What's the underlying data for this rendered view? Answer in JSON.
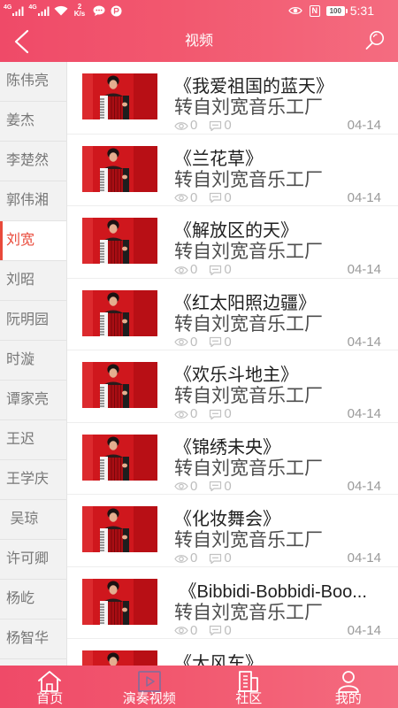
{
  "status_bar": {
    "network_1": "4G",
    "network_2": "4G",
    "speed_value": "2",
    "speed_unit": "K/s",
    "nfc_label": "N",
    "battery": "100",
    "time": "5:31",
    "icons": [
      "signal-icon",
      "signal-icon",
      "wifi-icon",
      "message-bubble-icon",
      "app-notification-icon",
      "eye-icon",
      "nfc-icon",
      "battery-icon"
    ]
  },
  "header": {
    "title": "视频",
    "back_icon": "chevron-left-icon",
    "search_icon": "search-icon"
  },
  "colors": {
    "brand_start": "#ef4a68",
    "brand_end": "#f46c80",
    "sidebar_active": "#e9493a",
    "sidebar_text": "#777777",
    "muted_text": "#9a9a9a",
    "nav_active_icon": "#8a6a98"
  },
  "sidebar": {
    "items": [
      {
        "name": "陈伟亮"
      },
      {
        "name": "姜杰"
      },
      {
        "name": "李楚然"
      },
      {
        "name": "郭伟湘"
      },
      {
        "name": "刘宽",
        "selected": true
      },
      {
        "name": "刘昭"
      },
      {
        "name": "阮明园"
      },
      {
        "name": "时漩"
      },
      {
        "name": "谭家亮"
      },
      {
        "name": "王迟"
      },
      {
        "name": "王学庆"
      },
      {
        "name": " 吴琼"
      },
      {
        "name": "许可卿"
      },
      {
        "name": "杨屹"
      },
      {
        "name": "杨智华"
      }
    ]
  },
  "videos": [
    {
      "title": "《我爱祖国的蓝天》",
      "source": "转自刘宽音乐工厂",
      "views": "0",
      "comments": "0",
      "date": "04-14"
    },
    {
      "title": "《兰花草》",
      "source": "转自刘宽音乐工厂",
      "views": "0",
      "comments": "0",
      "date": "04-14"
    },
    {
      "title": "《解放区的天》",
      "source": "转自刘宽音乐工厂",
      "views": "0",
      "comments": "0",
      "date": "04-14"
    },
    {
      "title": "《红太阳照边疆》",
      "source": "转自刘宽音乐工厂",
      "views": "0",
      "comments": "0",
      "date": "04-14"
    },
    {
      "title": "《欢乐斗地主》",
      "source": "转自刘宽音乐工厂",
      "views": "0",
      "comments": "0",
      "date": "04-14"
    },
    {
      "title": "《锦绣未央》",
      "source": "转自刘宽音乐工厂",
      "views": "0",
      "comments": "0",
      "date": "04-14"
    },
    {
      "title": "《化妆舞会》",
      "source": "转自刘宽音乐工厂",
      "views": "0",
      "comments": "0",
      "date": "04-14"
    },
    {
      "title": " 《Bibbidi-Bobbidi-Boo...",
      "source": "转自刘宽音乐工厂",
      "views": "0",
      "comments": "0",
      "date": "04-14"
    },
    {
      "title": "《大风车》"
    }
  ],
  "bottom_nav": {
    "tabs": [
      {
        "label": "首页",
        "icon": "home-icon"
      },
      {
        "label": "演奏视频",
        "icon": "video-play-icon",
        "active": true
      },
      {
        "label": "社区",
        "icon": "community-icon"
      },
      {
        "label": "我的",
        "icon": "profile-icon"
      }
    ]
  }
}
